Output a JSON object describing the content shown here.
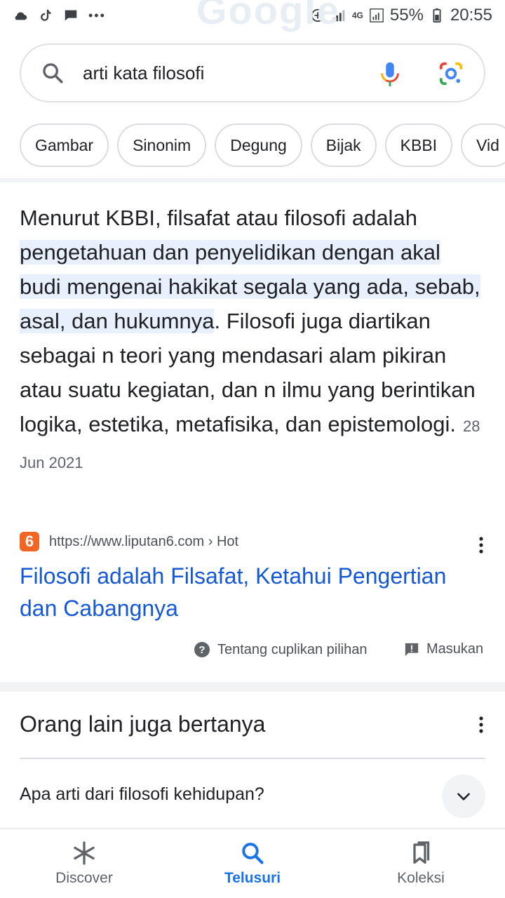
{
  "status_bar": {
    "battery": "55%",
    "time": "20:55",
    "network": "4G",
    "overflow": "•••"
  },
  "search": {
    "query": "arti kata filosofi"
  },
  "chips": [
    "Gambar",
    "Sinonim",
    "Degung",
    "Bijak",
    "KBBI",
    "Vid"
  ],
  "snippet": {
    "text_before": "Menurut KBBI, filsafat atau filosofi adalah ",
    "highlight": "pengetahuan dan penyelidikan dengan akal budi mengenai hakikat segala yang ada, sebab, asal, dan hukumnya",
    "text_after": ". Filosofi juga diartikan sebagai n teori yang mendasari alam pikiran atau suatu kegiatan, dan n ilmu yang berintikan logika, estetika, metafisika, dan epistemologi.",
    "date": "28 Jun 2021"
  },
  "result": {
    "favicon_text": "6",
    "url": "https://www.liputan6.com › Hot",
    "title": "Filosofi adalah Filsafat, Ketahui Pengertian dan Cabangnya"
  },
  "snippet_footer": {
    "about": "Tentang cuplikan pilihan",
    "feedback": "Masukan"
  },
  "paa": {
    "title": "Orang lain juga bertanya",
    "questions": [
      "Apa arti dari filosofi kehidupan?"
    ]
  },
  "bottom_nav": {
    "items": [
      {
        "label": "Discover",
        "icon": "asterisk-icon"
      },
      {
        "label": "Telusuri",
        "icon": "search-icon"
      },
      {
        "label": "Koleksi",
        "icon": "bookmarks-icon"
      }
    ],
    "active": "Telusuri"
  },
  "colors": {
    "link": "#1558d6",
    "highlight": "#e8f0fe",
    "active_nav": "#1a73e8",
    "favicon": "#f26522"
  }
}
